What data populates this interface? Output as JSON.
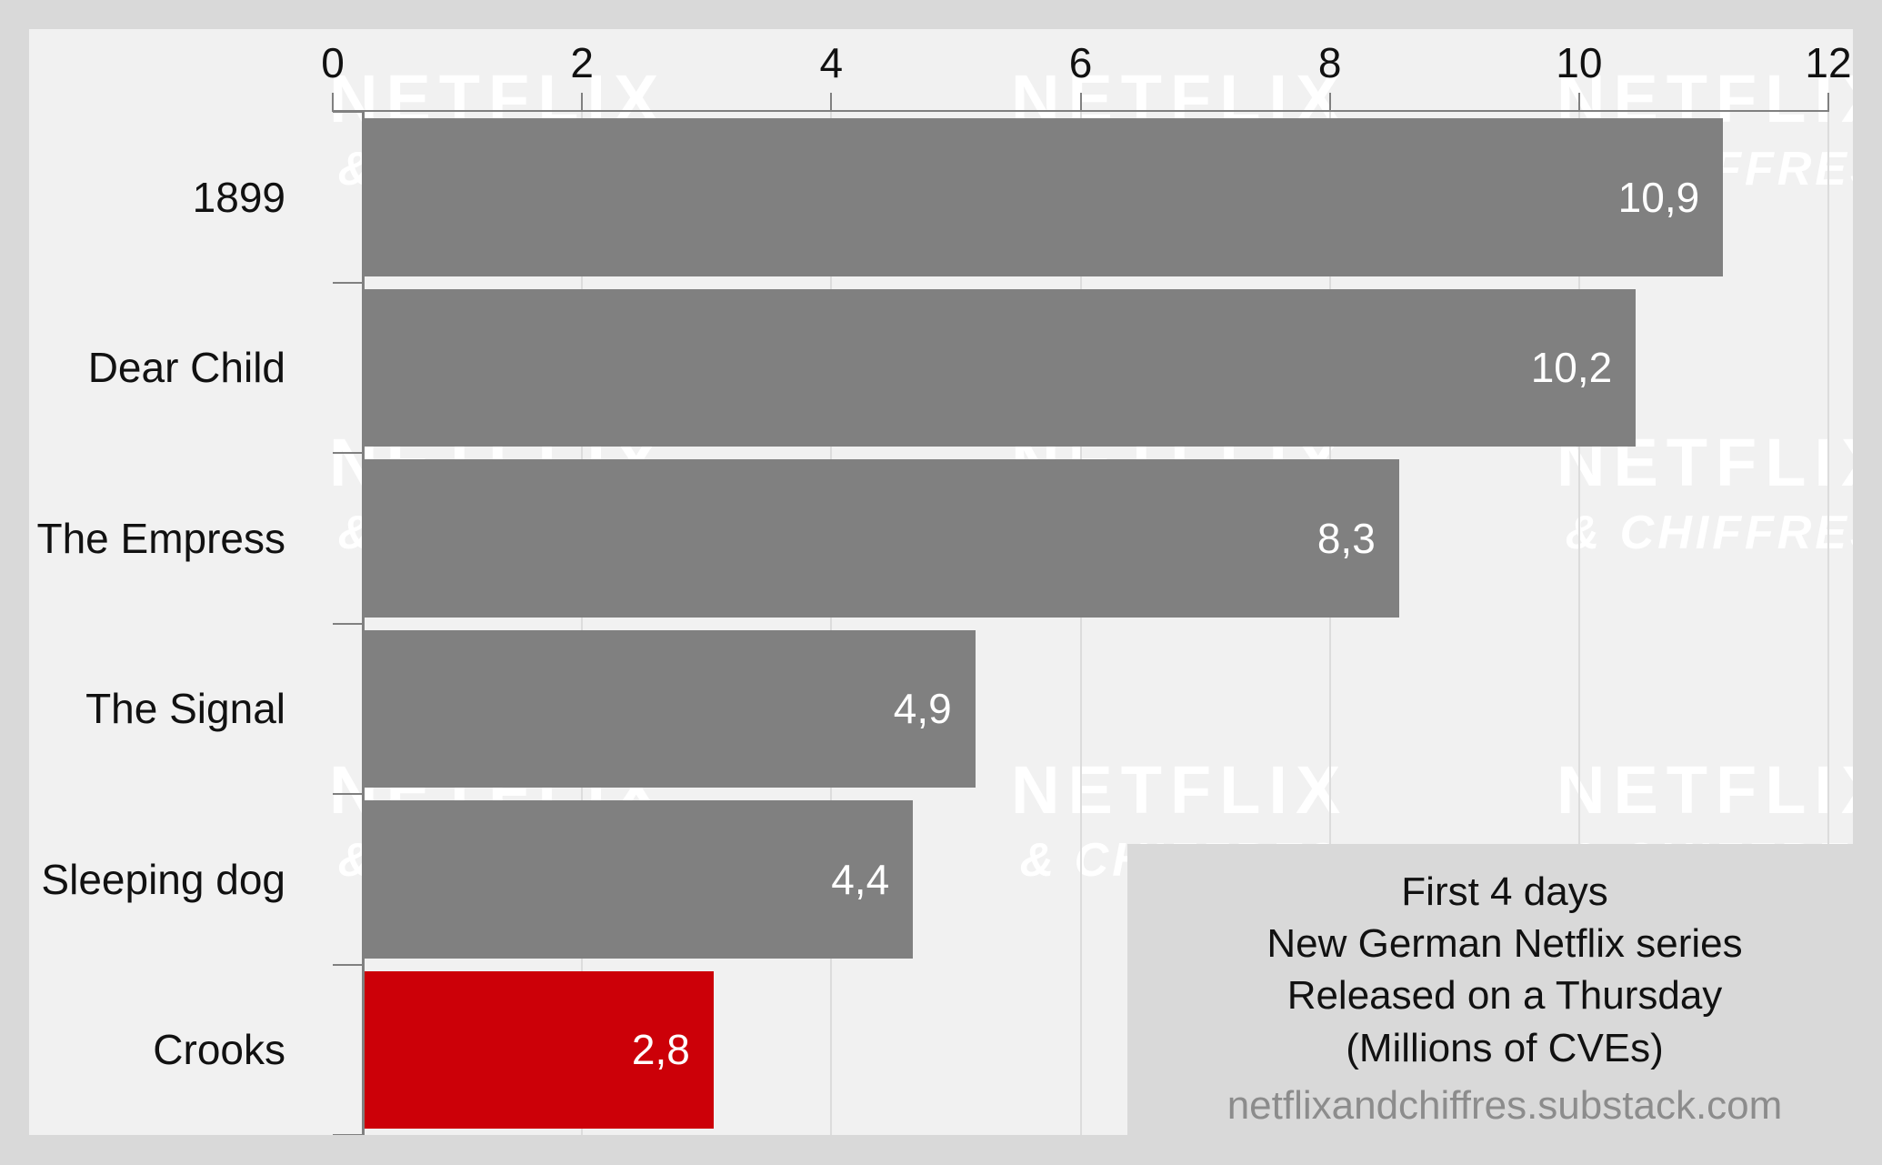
{
  "chart_data": {
    "type": "bar",
    "orientation": "horizontal",
    "title": "",
    "xlabel": "",
    "ylabel": "",
    "xlim": [
      0,
      12
    ],
    "grid": true,
    "axis_position": "top",
    "decimal_separator": ",",
    "categories": [
      "1899",
      "Dear Child",
      "The Empress",
      "The Signal",
      "Sleeping dog",
      "Crooks"
    ],
    "values": [
      10.9,
      10.2,
      8.3,
      4.9,
      4.4,
      2.8
    ],
    "value_labels": [
      "10,9",
      "10,2",
      "8,3",
      "4,9",
      "4,4",
      "2,8"
    ],
    "bar_colors": [
      "#808080",
      "#808080",
      "#808080",
      "#808080",
      "#808080",
      "#cc0008"
    ],
    "highlight_index": 5,
    "x_ticks": [
      0,
      2,
      4,
      6,
      8,
      10,
      12
    ],
    "x_tick_labels": [
      "0",
      "2",
      "4",
      "6",
      "8",
      "10",
      "12"
    ],
    "legend": null
  },
  "colors": {
    "figure_background": "#d9d9d9",
    "panel_background": "#f1f1f1",
    "bar_gray": "#808080",
    "bar_red": "#cc0008",
    "axis": "#808080",
    "gridline": "#dcdcdc",
    "text": "#111111",
    "value_text": "#ffffff",
    "source_text": "#8c8c8c",
    "watermark": "#ffffff"
  },
  "annotation": {
    "lines": [
      "First 4 days",
      "New German Netflix series",
      "Released on a Thursday",
      "(Millions of CVEs)"
    ],
    "source": "netflixandchiffres.substack.com"
  },
  "watermark": {
    "line1": "NETFLIX",
    "line2": "& CHIFFRES"
  }
}
